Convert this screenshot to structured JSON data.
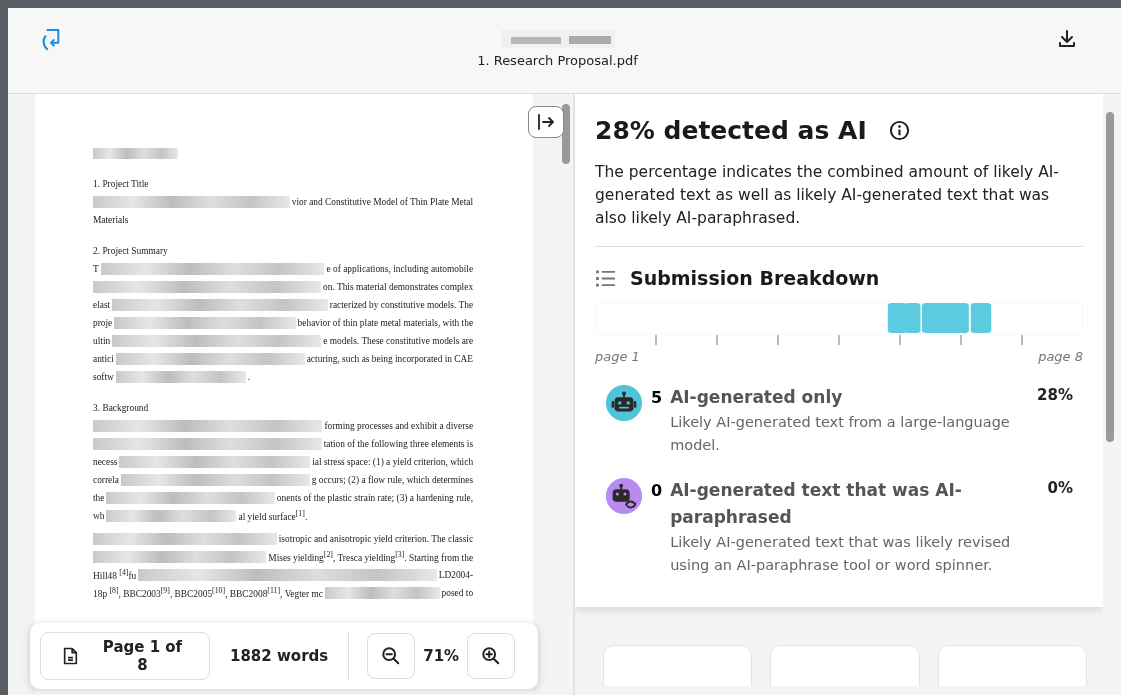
{
  "header": {
    "file_name": "1. Research Proposal.pdf"
  },
  "document": {
    "lines": [
      {
        "kind": "heading-redacted",
        "segments": [
          {
            "kind": "redacted"
          }
        ]
      },
      {
        "kind": "heading",
        "segments": [
          {
            "kind": "text",
            "text": "1. Project Title"
          }
        ]
      },
      {
        "kind": "line",
        "segments": [
          {
            "kind": "redacted"
          },
          {
            "kind": "text",
            "text": "vior and Constitutive Model of Thin Plate Metal"
          }
        ]
      },
      {
        "kind": "last",
        "segments": [
          {
            "kind": "text",
            "text": "Materials"
          }
        ]
      },
      {
        "kind": "heading",
        "segments": [
          {
            "kind": "text",
            "text": "2. Project Summary"
          }
        ]
      },
      {
        "kind": "line",
        "segments": [
          {
            "kind": "text",
            "text": "T"
          },
          {
            "kind": "redacted"
          },
          {
            "kind": "text",
            "text": "e of applications, including automobile"
          }
        ]
      },
      {
        "kind": "line",
        "segments": [
          {
            "kind": "redacted"
          },
          {
            "kind": "text",
            "text": "on. This material demonstrates complex"
          }
        ]
      },
      {
        "kind": "line",
        "segments": [
          {
            "kind": "text",
            "text": "elast"
          },
          {
            "kind": "redacted"
          },
          {
            "kind": "text",
            "text": "racterized by constitutive models. The"
          }
        ]
      },
      {
        "kind": "line",
        "segments": [
          {
            "kind": "text",
            "text": "proje"
          },
          {
            "kind": "redacted"
          },
          {
            "kind": "text",
            "text": "behavior of thin plate metal materials, with the"
          }
        ]
      },
      {
        "kind": "line",
        "segments": [
          {
            "kind": "text",
            "text": "ultin"
          },
          {
            "kind": "redacted"
          },
          {
            "kind": "text",
            "text": "e models. These constitutive models are"
          }
        ]
      },
      {
        "kind": "line",
        "segments": [
          {
            "kind": "text",
            "text": "antici"
          },
          {
            "kind": "redacted"
          },
          {
            "kind": "text",
            "text": "acturing, such as being incorporated in CAE"
          }
        ]
      },
      {
        "kind": "last",
        "segments": [
          {
            "kind": "text",
            "text": "softw"
          },
          {
            "kind": "redacted-short"
          },
          {
            "kind": "text",
            "text": "."
          }
        ]
      },
      {
        "kind": "heading",
        "segments": [
          {
            "kind": "text",
            "text": "3. Background"
          }
        ]
      },
      {
        "kind": "line",
        "segments": [
          {
            "kind": "redacted"
          },
          {
            "kind": "text",
            "text": "forming processes and exhibit a diverse"
          }
        ]
      },
      {
        "kind": "line",
        "segments": [
          {
            "kind": "redacted"
          },
          {
            "kind": "text",
            "text": "tation of the following three elements is"
          }
        ]
      },
      {
        "kind": "line",
        "segments": [
          {
            "kind": "text",
            "text": "necess"
          },
          {
            "kind": "redacted"
          },
          {
            "kind": "text",
            "text": "ial stress space: (1) a yield criterion, which"
          }
        ]
      },
      {
        "kind": "line",
        "segments": [
          {
            "kind": "text",
            "text": "correla"
          },
          {
            "kind": "redacted"
          },
          {
            "kind": "text",
            "text": "g occurs; (2) a flow rule, which determines"
          }
        ]
      },
      {
        "kind": "line",
        "segments": [
          {
            "kind": "text",
            "text": "the"
          },
          {
            "kind": "redacted"
          },
          {
            "kind": "text",
            "text": "onents of the plastic strain rate; (3) a hardening rule,"
          }
        ]
      },
      {
        "kind": "last",
        "segments": [
          {
            "kind": "text",
            "text": "wh"
          },
          {
            "kind": "redacted-short"
          },
          {
            "kind": "text",
            "text": "al yield surface$^{[1]}$."
          }
        ]
      },
      {
        "kind": "line",
        "segments": [
          {
            "kind": "redacted"
          },
          {
            "kind": "text",
            "text": "isotropic and anisotropic yield criterion. The classic"
          }
        ]
      },
      {
        "kind": "line",
        "segments": [
          {
            "kind": "redacted"
          },
          {
            "kind": "text",
            "text": "Mises yielding$^{[2]}$, Tresca yielding$^{[3]}$. Starting from the"
          }
        ]
      },
      {
        "kind": "line",
        "segments": [
          {
            "kind": "text",
            "text": "Hill48 $^{[4]}$fu"
          },
          {
            "kind": "redacted"
          },
          {
            "kind": "text",
            "text": "LD2004-"
          }
        ]
      },
      {
        "kind": "line",
        "segments": [
          {
            "kind": "text",
            "text": "18p $^{[8]}$, BBC2003$^{[9]}$, BBC2005$^{[10]}$, BBC2008$^{[11]}$, Vegter mc"
          },
          {
            "kind": "redacted"
          },
          {
            "kind": "text",
            "text": "posed to"
          }
        ]
      }
    ]
  },
  "toolbar": {
    "page_label": "Page 1 of 8",
    "word_count": "1882 words",
    "zoom": "71%"
  },
  "report": {
    "title": "28% detected as AI",
    "description": "The percentage indicates the combined amount of likely AI-generated text as well as likely AI-generated text that was also likely AI-paraphrased.",
    "breakdown_title": "Submission Breakdown",
    "start_label": "page 1",
    "end_label": "page 8",
    "categories": [
      {
        "kind": "generated",
        "color": "#4fc3d9",
        "count": "5",
        "title": "AI-generated only",
        "description": "Likely AI-generated text from a large-language model.",
        "percent": "28%"
      },
      {
        "kind": "paraphrased",
        "color": "#b98af0",
        "count": "0",
        "title": "AI-generated text that was AI-paraphrased",
        "description": "Likely AI-generated text that was likely revised using an AI-paraphrase tool or word spinner.",
        "percent": "0%"
      }
    ]
  }
}
